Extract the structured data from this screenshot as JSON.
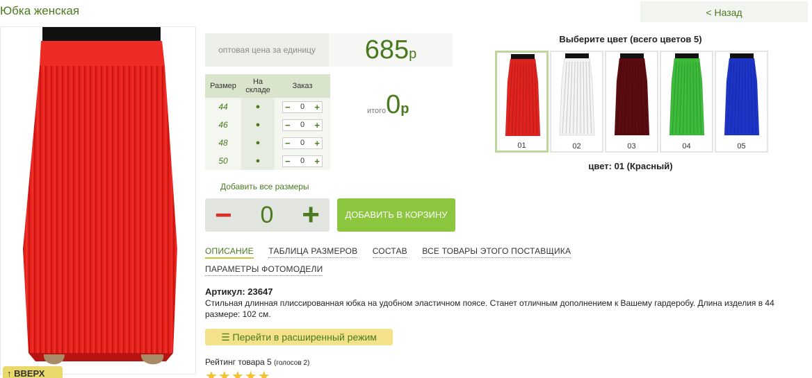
{
  "page": {
    "title": "Юбка женская",
    "back_label": "< Назад"
  },
  "photo": {
    "scroll_label": "↑ ВВЕРХ"
  },
  "price": {
    "label": "оптовая цена за единицу",
    "value": "685",
    "currency": "р"
  },
  "size_table": {
    "headers": [
      "Размер",
      "На складе",
      "Заказ"
    ],
    "rows": [
      {
        "size": "44",
        "stock": "●",
        "qty": "0"
      },
      {
        "size": "46",
        "stock": "●",
        "qty": "0"
      },
      {
        "size": "48",
        "stock": "●",
        "qty": "0"
      },
      {
        "size": "50",
        "stock": "●",
        "qty": "0"
      }
    ],
    "minus": "−",
    "plus": "+"
  },
  "total": {
    "label": "итого",
    "value": "0",
    "currency": "р"
  },
  "add_all_sizes": "Добавить все размеры",
  "quantity": {
    "minus": "−",
    "value": "0",
    "plus": "+"
  },
  "cart_button": "ДОБАВИТЬ В КОРЗИНУ",
  "tabs": [
    {
      "label": "ОПИСАНИЕ",
      "active": true
    },
    {
      "label": "ТАБЛИЦА РАЗМЕРОВ"
    },
    {
      "label": "СОСТАВ"
    },
    {
      "label": "ВСЕ ТОВАРЫ ЭТОГО ПОСТАВЩИКА"
    },
    {
      "label": "ПАРАМЕТРЫ ФОТОМОДЕЛИ"
    }
  ],
  "article": "Артикул: 23647",
  "description": "Стильная длинная плиссированная юбка на удобном эластичном поясе. Станет отличным дополнением к Вашему гардеробу. Длина изделия в 44 размере: 102 см.",
  "extended_mode": "Перейти в расширенный режим",
  "rating": {
    "text": "Рейтинг товара 5",
    "votes": "(голосов 2)",
    "stars": "★★★★★"
  },
  "colors": {
    "title": "Выберите цвет (всего цветов 5)",
    "selected_text": "цвет: 01 (Красный)",
    "items": [
      {
        "num": "01",
        "color": "#e0231f",
        "selected": true
      },
      {
        "num": "02",
        "color": "#f4f4f4"
      },
      {
        "num": "03",
        "color": "#5a0b10"
      },
      {
        "num": "04",
        "color": "#3dbb3a"
      },
      {
        "num": "05",
        "color": "#1c35c8"
      }
    ]
  },
  "main_color": "#e0231f",
  "accent_color": "#4a7a1e"
}
